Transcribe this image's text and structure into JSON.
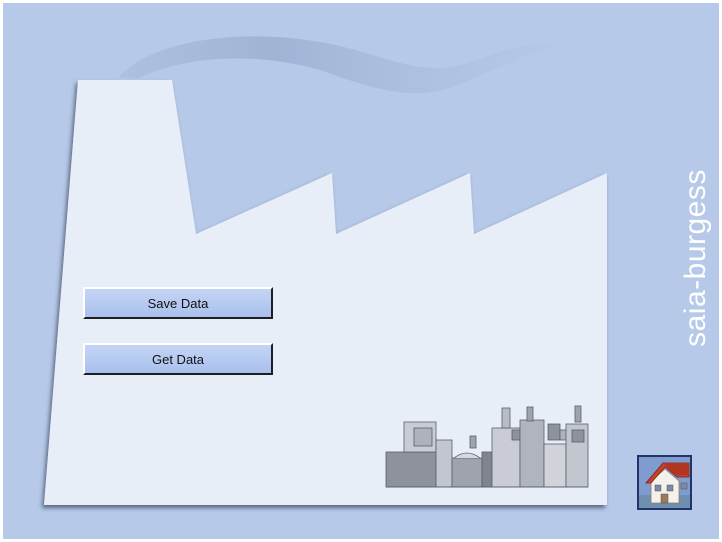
{
  "app": {
    "background_color": "#b6c9e8",
    "factory_color": "#e8eef8",
    "smoke_color": "#9fb2d4"
  },
  "buttons": {
    "save_label": "Save Data",
    "get_label": "Get Data"
  },
  "branding": {
    "text": "saia-burgess"
  },
  "home": {
    "icon": "house-icon"
  },
  "illustration": {
    "icon": "machinery-icon"
  }
}
